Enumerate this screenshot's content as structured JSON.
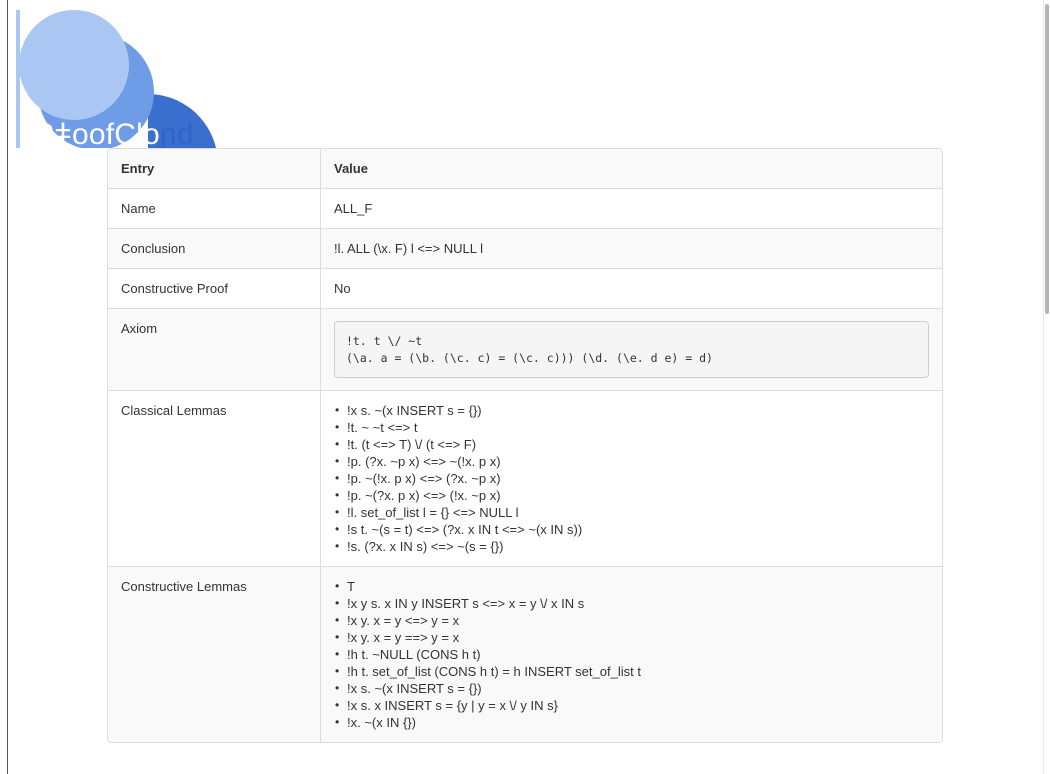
{
  "logo": {
    "text_prefix": "P",
    "text_mid": "ǂ",
    "text_main": "oofClo",
    "text_suffix": "ɲd",
    "colors": {
      "light": "#a9c7f2",
      "mid": "#6f9ce6",
      "dark": "#3a6fd0"
    }
  },
  "table": {
    "headers": {
      "entry": "Entry",
      "value": "Value"
    },
    "name": {
      "label": "Name",
      "value": "ALL_F"
    },
    "conclusion": {
      "label": "Conclusion",
      "value": "!l. ALL (\\x. F) l <=> NULL l"
    },
    "constructive": {
      "label": "Constructive Proof",
      "value": "No"
    },
    "axiom": {
      "label": "Axiom",
      "lines": [
        "!t. t \\/ ~t",
        "(\\a. a = (\\b. (\\c. c) = (\\c. c))) (\\d. (\\e. d e) = d)"
      ]
    },
    "classical": {
      "label": "Classical Lemmas",
      "items": [
        "!x s. ~(x INSERT s = {})",
        "!t. ~ ~t <=> t",
        "!t. (t <=> T) \\/ (t <=> F)",
        "!p. (?x. ~p x) <=> ~(!x. p x)",
        "!p. ~(!x. p x) <=> (?x. ~p x)",
        "!p. ~(?x. p x) <=> (!x. ~p x)",
        "!l. set_of_list l = {} <=> NULL l",
        "!s t. ~(s = t) <=> (?x. x IN t <=> ~(x IN s))",
        "!s. (?x. x IN s) <=> ~(s = {})"
      ]
    },
    "constructive_lemmas": {
      "label": "Constructive Lemmas",
      "items": [
        "T",
        "!x y s. x IN y INSERT s <=> x = y \\/ x IN s",
        "!x y. x = y <=> y = x",
        "!x y. x = y ==> y = x",
        "!h t. ~NULL (CONS h t)",
        "!h t. set_of_list (CONS h t) = h INSERT set_of_list t",
        "!x s. ~(x INSERT s = {})",
        "!x s. x INSERT s = {y | y = x \\/ y IN s}",
        "!x. ~(x IN {})"
      ]
    }
  }
}
